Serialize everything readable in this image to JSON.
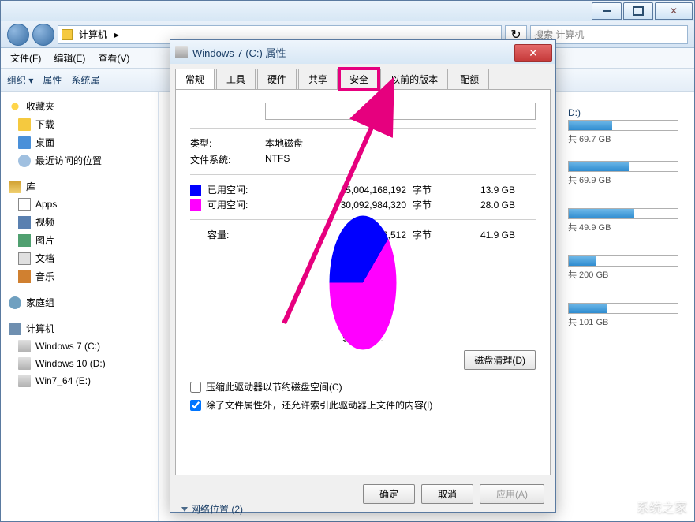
{
  "explorer": {
    "breadcrumb": "计算机",
    "search_placeholder": "搜索 计算机",
    "menu": {
      "file": "文件(F)",
      "edit": "编辑(E)",
      "view": "查看(V)"
    },
    "toolbar": {
      "organize": "组织 ▾",
      "properties": "属性",
      "sysprops": "系统属"
    },
    "nav": {
      "favorites": "收藏夹",
      "downloads": "下载",
      "desktop": "桌面",
      "recent": "最近访问的位置",
      "libraries": "库",
      "apps": "Apps",
      "video": "视频",
      "pictures": "图片",
      "documents": "文档",
      "music": "音乐",
      "homegroup": "家庭组",
      "computer": "计算机",
      "c": "Windows 7 (C:)",
      "d": "Windows 10 (D:)",
      "e": "Win7_64 (E:)"
    },
    "drives": [
      {
        "label": "D:)",
        "free": "共 69.7 GB",
        "fill": 40
      },
      {
        "label": "",
        "free": "共 69.9 GB",
        "fill": 55
      },
      {
        "label": "",
        "free": "共 49.9 GB",
        "fill": 60
      },
      {
        "label": "",
        "free": "共 200 GB",
        "fill": 25
      },
      {
        "label": "",
        "free": "共 101 GB",
        "fill": 35
      }
    ],
    "network_location": "网络位置 (2)"
  },
  "dialog": {
    "title": "Windows 7 (C:) 属性",
    "tabs": {
      "general": "常规",
      "tools": "工具",
      "hardware": "硬件",
      "share": "共享",
      "security": "安全",
      "prev": "以前的版本",
      "quota": "配额"
    },
    "type_label": "类型:",
    "type_value": "本地磁盘",
    "fs_label": "文件系统:",
    "fs_value": "NTFS",
    "used_label": "已用空间:",
    "used_bytes": "15,004,168,192",
    "used_unit": "字节",
    "used_gb": "13.9 GB",
    "free_label": "可用空间:",
    "free_bytes": "30,092,984,320",
    "free_unit": "字节",
    "free_gb": "28.0 GB",
    "cap_label": "容量:",
    "cap_bytes": "45,097,152,512",
    "cap_unit": "字节",
    "cap_gb": "41.9 GB",
    "drive_label": "驱动器 C:",
    "cleanup": "磁盘清理(D)",
    "compress": "压缩此驱动器以节约磁盘空间(C)",
    "index": "除了文件属性外，还允许索引此驱动器上文件的内容(I)",
    "ok": "确定",
    "cancel": "取消",
    "apply": "应用(A)"
  },
  "watermark": "系统之家",
  "chart_data": {
    "type": "pie",
    "title": "驱动器 C:",
    "series": [
      {
        "name": "已用空间",
        "value": 13.9,
        "unit": "GB",
        "bytes": 15004168192,
        "color": "#0000ff"
      },
      {
        "name": "可用空间",
        "value": 28.0,
        "unit": "GB",
        "bytes": 30092984320,
        "color": "#ff00ff"
      }
    ],
    "total": {
      "name": "容量",
      "value": 41.9,
      "unit": "GB",
      "bytes": 45097152512
    }
  }
}
